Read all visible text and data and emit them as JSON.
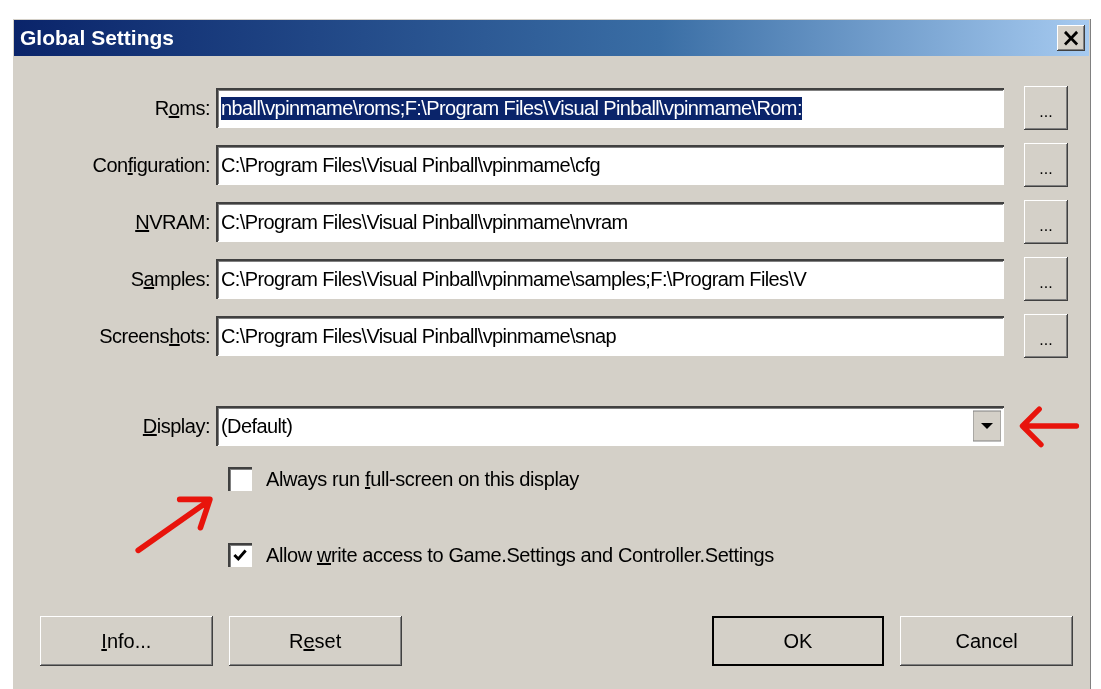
{
  "window": {
    "title": "Global Settings",
    "close_label": "×"
  },
  "paths": [
    {
      "label": {
        "pre": "R",
        "key": "o",
        "post": "ms:"
      },
      "value": "nball\\vpinmame\\roms;F:\\Program Files\\Visual Pinball\\vpinmame\\Rom:",
      "text_selected": true,
      "browse": "..."
    },
    {
      "label": {
        "pre": "Con",
        "key": "f",
        "post": "iguration:"
      },
      "value": "C:\\Program Files\\Visual Pinball\\vpinmame\\cfg",
      "text_selected": false,
      "browse": "..."
    },
    {
      "label": {
        "key": "N",
        "post": "VRAM:"
      },
      "value": "C:\\Program Files\\Visual Pinball\\vpinmame\\nvram",
      "text_selected": false,
      "browse": "..."
    },
    {
      "label": {
        "pre": "S",
        "key": "a",
        "post": "mples:"
      },
      "value": "C:\\Program Files\\Visual Pinball\\vpinmame\\samples;F:\\Program Files\\V",
      "text_selected": false,
      "browse": "..."
    },
    {
      "label": {
        "pre": "Screens",
        "key": "h",
        "post": "ots:"
      },
      "value": "C:\\Program Files\\Visual Pinball\\vpinmame\\snap",
      "text_selected": false,
      "browse": "..."
    }
  ],
  "display": {
    "label": {
      "key": "D",
      "post": "isplay:"
    },
    "value": "(Default)"
  },
  "checkboxes": [
    {
      "label": {
        "pre": "Always run ",
        "key": "f",
        "post": "ull-screen on this display"
      },
      "checked": false
    },
    {
      "label": {
        "pre": "Allow ",
        "key": "w",
        "post": "rite access to Game.Settings and Controller.Settings"
      },
      "checked": true
    }
  ],
  "buttons": [
    {
      "label": {
        "key": "I",
        "post": "nfo..."
      },
      "kind": "normal"
    },
    {
      "label": {
        "pre": "R",
        "key": "e",
        "post": "set"
      },
      "kind": "normal"
    },
    {
      "label": {
        "post": "OK"
      },
      "kind": "default"
    },
    {
      "label": {
        "post": "Cancel"
      },
      "kind": "normal"
    }
  ]
}
